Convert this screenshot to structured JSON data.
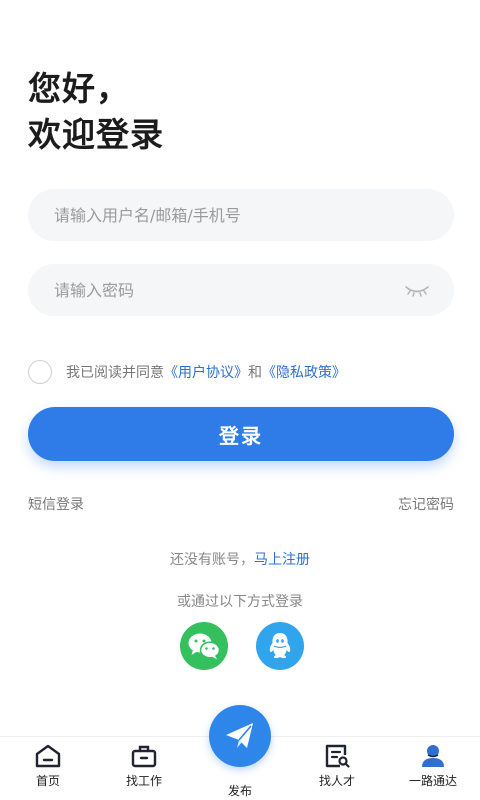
{
  "greeting": {
    "line1": "您好，",
    "line2": "欢迎登录"
  },
  "form": {
    "username_placeholder": "请输入用户名/邮箱/手机号",
    "password_placeholder": "请输入密码",
    "username_value": "",
    "password_value": ""
  },
  "agreement": {
    "prefix": "我已阅读并同意",
    "user_agreement": "《用户协议》",
    "and": "和",
    "privacy_policy": "《隐私政策》",
    "checked": false
  },
  "login_button": "登录",
  "links": {
    "sms_login": "短信登录",
    "forgot_password": "忘记密码"
  },
  "register": {
    "prompt": "还没有账号，",
    "link": "马上注册"
  },
  "other_login": {
    "label": "或通过以下方式登录",
    "methods": [
      "wechat-icon",
      "qq-icon"
    ]
  },
  "tabbar": {
    "items": [
      {
        "label": "首页",
        "icon": "home-icon"
      },
      {
        "label": "找工作",
        "icon": "briefcase-icon"
      },
      {
        "label": "发布",
        "icon": "paper-plane-icon"
      },
      {
        "label": "找人才",
        "icon": "resume-search-icon"
      },
      {
        "label": "一路通达",
        "icon": "profile-icon"
      }
    ]
  },
  "colors": {
    "primary": "#2f7be8",
    "link": "#2f6fd1",
    "wechat": "#35c05e",
    "qq": "#31a4ee"
  }
}
